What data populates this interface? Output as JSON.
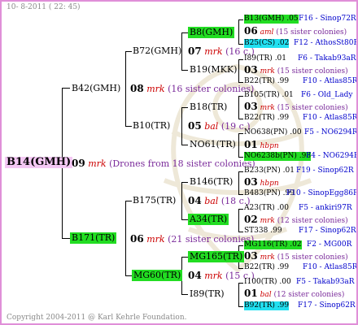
{
  "header": {
    "date": "10- 8-2011 ( 22: 45)"
  },
  "footer": {
    "copyright": "Copyright 2004-2011 @ Karl Kehrle Foundation."
  },
  "root": {
    "label": "B14(GMH)",
    "num": "09",
    "breeder": "mrk",
    "desc": "(Drones from 18 sister colonies)"
  },
  "g1": {
    "a": {
      "label": "B42(GMH)",
      "num": "08",
      "breeder": "mrk",
      "desc": "(16 sister colonies)"
    },
    "b": {
      "label": "B171(TR)",
      "num": "06",
      "breeder": "mrk",
      "desc": "(21 sister colonies)"
    }
  },
  "g2": {
    "aa": {
      "label": "B72(GMH)",
      "num": "07",
      "breeder": "mrk",
      "desc": "(16 c.)"
    },
    "ab": {
      "label": "B10(TR)",
      "num": "05",
      "breeder": "bal",
      "desc": "(19 c.)"
    },
    "ba": {
      "label": "B175(TR)",
      "num": "04",
      "breeder": "bal",
      "desc": "(18 c.)"
    },
    "bb": {
      "label": "MG60(TR)",
      "num": "04",
      "breeder": "mrk",
      "desc": "(15 c.)"
    }
  },
  "g3": {
    "aaa": {
      "label": "B8(GMH)"
    },
    "aab": {
      "label": "B19(MKK)"
    },
    "aba": {
      "label": "B18(TR)"
    },
    "abb": {
      "label": "NO61(TR)"
    },
    "baa": {
      "label": "B146(TR)"
    },
    "bab": {
      "label": "A34(TR)"
    },
    "bba": {
      "label": "MG165(TR)"
    },
    "bbb": {
      "label": "I89(TR)"
    }
  },
  "g4": [
    {
      "label": "B13(GMH)",
      "year": ".05",
      "code": "F16 - Sinop72R"
    },
    {
      "num": "06",
      "breeder": "aml",
      "desc": "(15 sister colonies)"
    },
    {
      "label": "B25(CS)",
      "year": ".02",
      "code": "F12 - AthosSt80R"
    },
    {
      "label": "I89(TR)",
      "year": ".01",
      "code": "F6 - Takab93aR"
    },
    {
      "num": "03",
      "breeder": "mrk",
      "desc": "(15 sister colonies)"
    },
    {
      "label": "B22(TR)",
      "year": ".99",
      "code": "F10 - Atlas85R"
    },
    {
      "label": "B105(TR)",
      "year": ".01",
      "code": "F6 - Old_Lady"
    },
    {
      "num": "03",
      "breeder": "mrk",
      "desc": "(15 sister colonies)"
    },
    {
      "label": "B22(TR)",
      "year": ".99",
      "code": "F10 - Atlas85R"
    },
    {
      "label": "NO638(PN)",
      "year": ".00",
      "code": "F5 - NO6294R"
    },
    {
      "num": "01",
      "breeder": "hbpn",
      "desc": ""
    },
    {
      "label": "NO6238b(PN)",
      "year": ".98",
      "code": "F4 - NO6294R"
    },
    {
      "label": "B233(PN)",
      "year": ".01",
      "code": "F19 - Sinop62R"
    },
    {
      "num": "03",
      "breeder": "hbpn",
      "desc": ""
    },
    {
      "label": "B483(PN)",
      "year": ".99",
      "code": "F10 - SinopEgg86R"
    },
    {
      "label": "A23(TR)",
      "year": ".00",
      "code": "F5 - ankiri97R"
    },
    {
      "num": "02",
      "breeder": "mrk",
      "desc": "(12 sister colonies)"
    },
    {
      "label": "ST338",
      "year": ".99",
      "code": "F17 - Sinop62R"
    },
    {
      "label": "MG116(TR)",
      "year": ".02",
      "code": "F2 - MG00R"
    },
    {
      "num": "03",
      "breeder": "mrk",
      "desc": "(15 sister colonies)"
    },
    {
      "label": "B22(TR)",
      "year": ".99",
      "code": "F10 - Atlas85R"
    },
    {
      "label": "I100(TR)",
      "year": ".00",
      "code": "F5 - Takab93aR"
    },
    {
      "num": "01",
      "breeder": "bal",
      "desc": "(12 sister colonies)"
    },
    {
      "label": "B92(TR)",
      "year": ".99",
      "code": "F17 - Sinop62R"
    }
  ]
}
